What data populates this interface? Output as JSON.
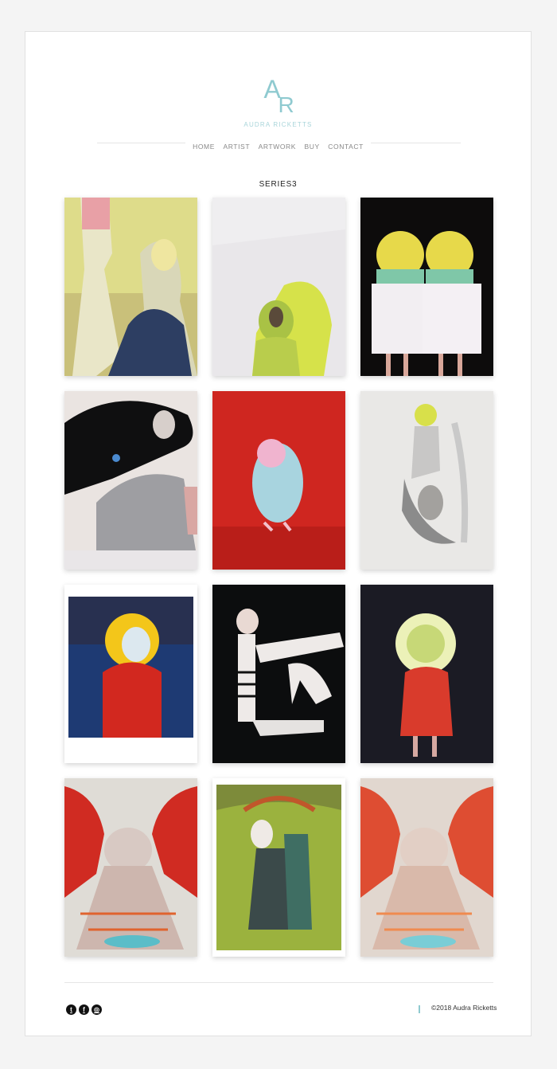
{
  "brand": {
    "mark_a": "A",
    "mark_r": "R",
    "name": "AUDRA RICKETTS",
    "color": "#8fcad0"
  },
  "nav": {
    "items": [
      "HOME",
      "ARTIST",
      "ARTWORK",
      "BUY",
      "CONTACT"
    ]
  },
  "page": {
    "title": "SERIES3"
  },
  "gallery": {
    "items": [
      {
        "name": "artwork-1"
      },
      {
        "name": "artwork-2"
      },
      {
        "name": "artwork-3"
      },
      {
        "name": "artwork-4"
      },
      {
        "name": "artwork-5"
      },
      {
        "name": "artwork-6"
      },
      {
        "name": "artwork-7"
      },
      {
        "name": "artwork-8"
      },
      {
        "name": "artwork-9"
      },
      {
        "name": "artwork-10"
      },
      {
        "name": "artwork-11"
      },
      {
        "name": "artwork-12"
      }
    ]
  },
  "footer": {
    "social": [
      {
        "icon": "twitter-icon",
        "glyph": "t"
      },
      {
        "icon": "facebook-icon",
        "glyph": "f"
      },
      {
        "icon": "instagram-icon",
        "glyph": "◎"
      }
    ],
    "copyright": "©2018 Audra Ricketts"
  }
}
